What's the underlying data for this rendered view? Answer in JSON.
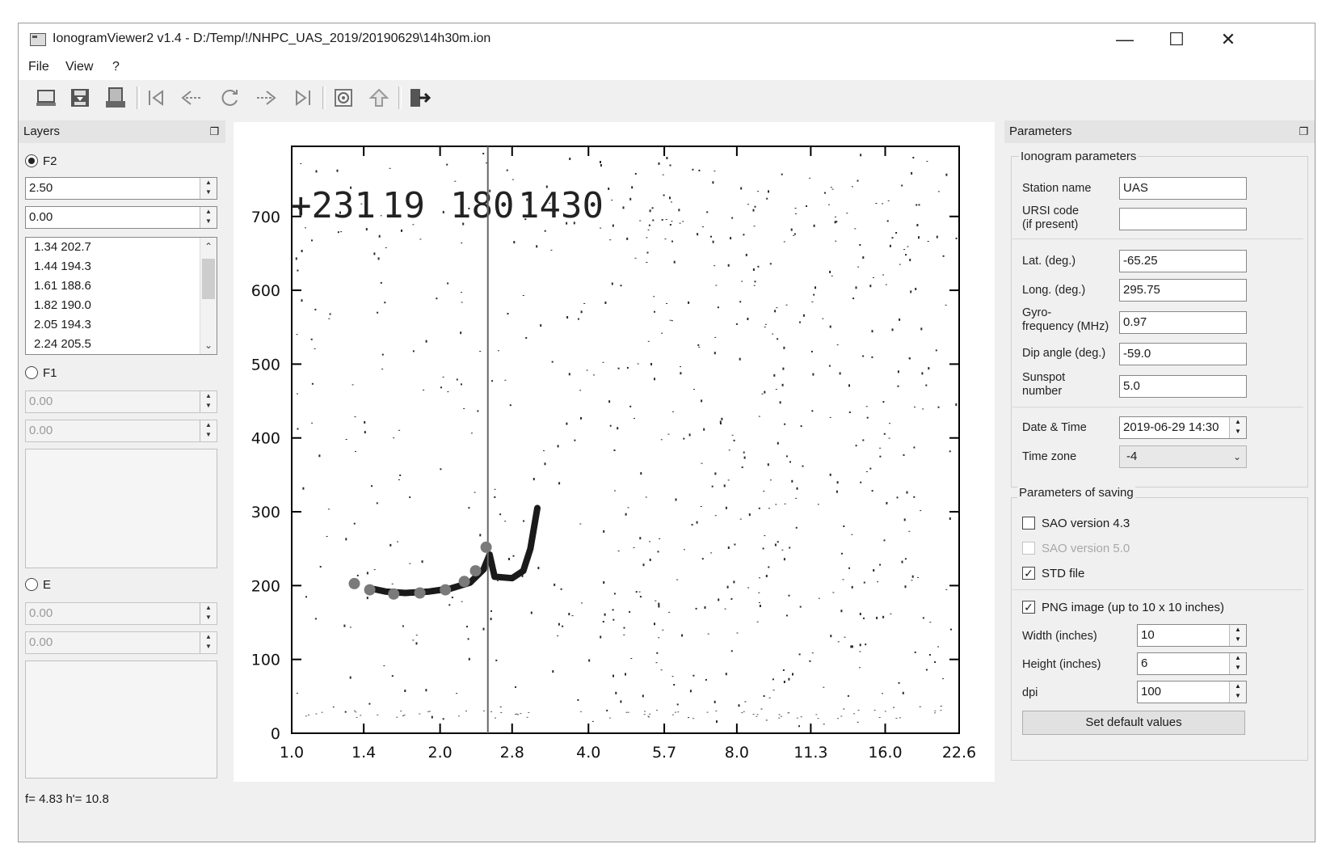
{
  "window": {
    "title": "IonogramViewer2 v1.4 - D:/Temp/!/NHPC_UAS_2019/20190629\\14h30m.ion",
    "controls": {
      "minimize": "—",
      "maximize": "☐",
      "close": "✕"
    }
  },
  "menu": {
    "items": [
      "File",
      "View",
      "?"
    ]
  },
  "toolbar": {
    "icons": [
      "open-file-icon",
      "save-icon",
      "print-icon",
      "first-icon",
      "previous-icon",
      "reload-icon",
      "next-icon",
      "last-icon",
      "zoom-icon",
      "up-icon",
      "exit-icon"
    ]
  },
  "layers": {
    "title": "Layers",
    "f2": {
      "label": "F2",
      "selected": true,
      "value1": "2.50",
      "value2": "0.00",
      "points": [
        "1.34 202.7",
        "1.44 194.3",
        "1.61 188.6",
        "1.82 190.0",
        "2.05 194.3",
        "2.24 205.5"
      ]
    },
    "f1": {
      "label": "F1",
      "selected": false,
      "value1": "0.00",
      "value2": "0.00"
    },
    "e": {
      "label": "E",
      "selected": false,
      "value1": "0.00",
      "value2": "0.00"
    }
  },
  "plot_header": {
    "code1": "+231",
    "code2": "19",
    "code3": "180",
    "code4": "1430"
  },
  "chart_data": {
    "type": "scatter",
    "title": "",
    "xlabel": "",
    "ylabel": "",
    "xscale": "log",
    "x_ticks": [
      1.0,
      1.4,
      2.0,
      2.8,
      4.0,
      5.7,
      8.0,
      11.3,
      16.0,
      22.6
    ],
    "x_tick_labels": [
      "1.0",
      "1.4",
      "2.0",
      "2.8",
      "4.0",
      "5.7",
      "8.0",
      "11.3",
      "16.0",
      "22.6"
    ],
    "y_ticks": [
      0,
      100,
      200,
      300,
      400,
      500,
      600,
      700
    ],
    "y_tick_labels": [
      "0",
      "100",
      "200",
      "300",
      "400",
      "500",
      "600",
      "700"
    ],
    "xlim": [
      1.0,
      22.6
    ],
    "ylim": [
      0,
      795
    ],
    "cursor_line_x": 2.5,
    "series": [
      {
        "points": [
          [
            1.34,
            202.7
          ],
          [
            1.44,
            194.3
          ],
          [
            1.61,
            188.6
          ],
          [
            1.82,
            190.0
          ],
          [
            2.05,
            194.3
          ],
          [
            2.24,
            205.5
          ],
          [
            2.36,
            220.0
          ],
          [
            2.48,
            252.0
          ]
        ],
        "color": "#7a7a7a"
      }
    ],
    "trace": [
      [
        1.45,
        196
      ],
      [
        1.55,
        192
      ],
      [
        1.7,
        190
      ],
      [
        1.9,
        192
      ],
      [
        2.1,
        196
      ],
      [
        2.3,
        204
      ],
      [
        2.45,
        222
      ],
      [
        2.52,
        242
      ],
      [
        2.58,
        212
      ],
      [
        2.8,
        210
      ],
      [
        2.95,
        220
      ],
      [
        3.05,
        250
      ],
      [
        3.15,
        305
      ]
    ],
    "colors": {
      "trace": "#1a1a1a",
      "noise": "#2a2a2a",
      "grid": "#000000"
    }
  },
  "parameters": {
    "title": "Parameters",
    "ionogram_group": "Ionogram parameters",
    "station_name": {
      "label": "Station name",
      "value": "UAS"
    },
    "ursi_code": {
      "label1": "URSI code",
      "label2": "(if present)",
      "value": ""
    },
    "lat": {
      "label": "Lat. (deg.)",
      "value": "-65.25"
    },
    "long": {
      "label": "Long. (deg.)",
      "value": "295.75"
    },
    "gyro": {
      "label1": "Gyro-",
      "label2": "frequency (MHz)",
      "value": "0.97"
    },
    "dip": {
      "label": "Dip angle (deg.)",
      "value": "-59.0"
    },
    "sunspot": {
      "label1": "Sunspot",
      "label2": "number",
      "value": "5.0"
    },
    "datetime": {
      "label": "Date & Time",
      "value": "2019-06-29 14:30"
    },
    "timezone": {
      "label": "Time zone",
      "value": "-4"
    },
    "saving_group": "Parameters of saving",
    "sao43": {
      "label": "SAO version 4.3",
      "checked": false
    },
    "sao50": {
      "label": "SAO version 5.0",
      "checked": false,
      "disabled": true
    },
    "std": {
      "label": "STD file",
      "checked": true
    },
    "png": {
      "label": "PNG image (up to 10 x 10 inches)",
      "checked": true
    },
    "width": {
      "label": "Width (inches)",
      "value": "10"
    },
    "height": {
      "label": "Height (inches)",
      "value": "6"
    },
    "dpi": {
      "label": "dpi",
      "value": "100"
    },
    "default_button": "Set default values"
  },
  "status": {
    "text": "f= 4.83  h'= 10.8"
  }
}
